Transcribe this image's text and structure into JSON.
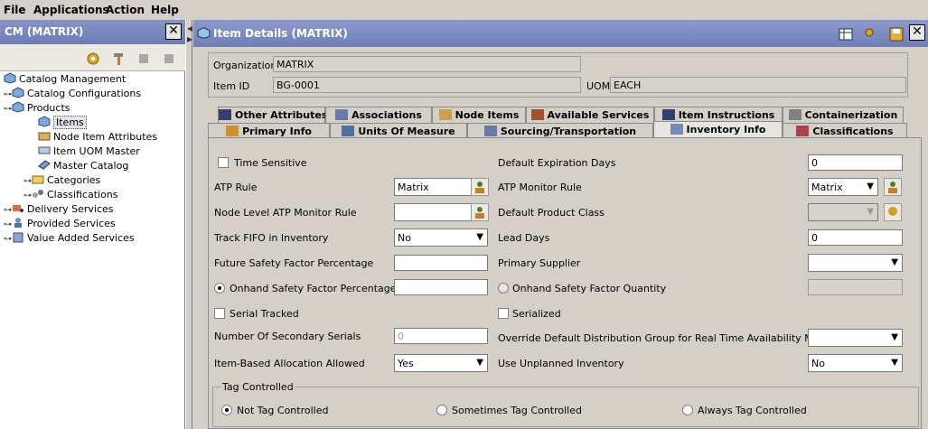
{
  "menu": {
    "file": "File",
    "applications": "Applications",
    "action": "Action",
    "help": "Help"
  },
  "left": {
    "title": "CM (MATRIX)",
    "close": "✕",
    "tree": [
      {
        "label": "Catalog Management"
      },
      {
        "label": "Catalog Configurations"
      },
      {
        "label": "Products"
      },
      {
        "label": "Items"
      },
      {
        "label": "Node Item Attributes"
      },
      {
        "label": "Item UOM Master"
      },
      {
        "label": "Master Catalog"
      },
      {
        "label": "Categories"
      },
      {
        "label": "Classifications"
      },
      {
        "label": "Delivery Services"
      },
      {
        "label": "Provided Services"
      },
      {
        "label": "Value Added Services"
      }
    ]
  },
  "right": {
    "title": "Item Details (MATRIX)",
    "close": "✕",
    "header": {
      "org_label": "Organization",
      "org_value": "MATRIX",
      "item_label": "Item ID",
      "item_value": "BG-0001",
      "uom_label": "UOM",
      "uom_value": "EACH"
    },
    "tabs_top": [
      "Other Attributes",
      "Associations",
      "Node Items",
      "Available Services",
      "Item Instructions",
      "Containerization"
    ],
    "tabs_bottom": [
      "Primary Info",
      "Units Of Measure",
      "Sourcing/Transportation",
      "Inventory Info",
      "Classifications"
    ],
    "form": {
      "time_sensitive": "Time Sensitive",
      "default_expiration_days": "Default Expiration Days",
      "default_expiration_days_value": "0",
      "atp_rule": "ATP Rule",
      "atp_rule_value": "Matrix",
      "atp_monitor_rule": "ATP Monitor Rule",
      "atp_monitor_rule_value": "Matrix",
      "node_level_atp": "Node Level ATP Monitor Rule",
      "node_level_atp_value": "",
      "default_product_class": "Default Product Class",
      "default_product_class_value": "",
      "track_fifo": "Track FIFO in Inventory",
      "track_fifo_value": "No",
      "lead_days": "Lead Days",
      "lead_days_value": "0",
      "future_safety": "Future Safety Factor Percentage",
      "future_safety_value": "",
      "primary_supplier": "Primary Supplier",
      "primary_supplier_value": "",
      "onhand_pct": "Onhand Safety Factor Percentage",
      "onhand_pct_value": "",
      "onhand_qty": "Onhand Safety Factor Quantity",
      "onhand_qty_value": "",
      "serial_tracked": "Serial Tracked",
      "serialized": "Serialized",
      "num_secondary_serials": "Number Of Secondary Serials",
      "num_secondary_serials_value": "0",
      "override_dist": "Override Default Distribution Group for Real Time Availability Monitor",
      "override_dist_value": "",
      "item_based_alloc": "Item-Based Allocation Allowed",
      "item_based_alloc_value": "Yes",
      "use_unplanned": "Use Unplanned Inventory",
      "use_unplanned_value": "No"
    },
    "tag": {
      "title": "Tag Controlled",
      "not": "Not Tag Controlled",
      "sometimes": "Sometimes Tag Controlled",
      "always": "Always Tag Controlled"
    }
  }
}
